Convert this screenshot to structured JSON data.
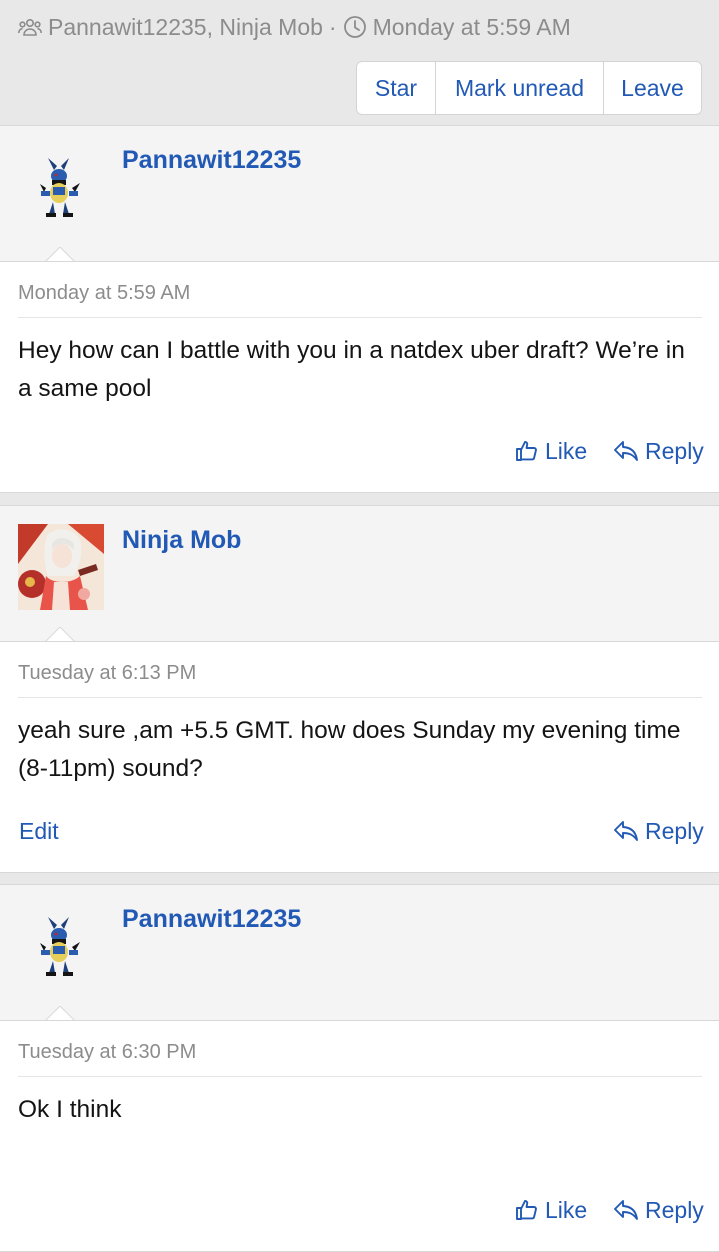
{
  "conversation": {
    "participants": "Pannawit12235, Ninja Mob",
    "separator": "·",
    "started": "Monday at 5:59 AM",
    "buttons": {
      "star": "Star",
      "mark_unread": "Mark unread",
      "leave": "Leave"
    }
  },
  "messages": [
    {
      "author": "Pannawit12235",
      "avatar": "lucario-sprite",
      "time": "Monday at 5:59 AM",
      "text": "Hey how can I battle with you in a natdex uber draft? We’re in a same pool",
      "actions": {
        "like": "Like",
        "reply": "Reply"
      }
    },
    {
      "author": "Ninja Mob",
      "avatar": "anime-artwork",
      "time": "Tuesday at 6:13 PM",
      "text": "yeah sure ,am +5.5 GMT. how does Sunday my evening time (8-11pm) sound?",
      "actions": {
        "edit": "Edit",
        "reply": "Reply"
      }
    },
    {
      "author": "Pannawit12235",
      "avatar": "lucario-sprite",
      "time": "Tuesday at 6:30 PM",
      "text": "Ok I think",
      "actions": {
        "like": "Like",
        "reply": "Reply"
      }
    }
  ],
  "colors": {
    "link": "#2159b5",
    "muted": "#8c8c8c",
    "header_bg": "#e8e8e8",
    "card_head_bg": "#f4f4f4"
  }
}
